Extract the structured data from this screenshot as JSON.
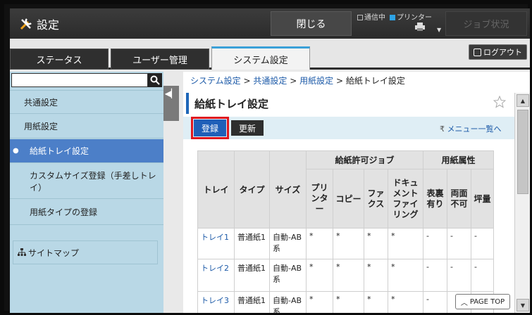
{
  "topbar": {
    "title": "設定",
    "close_label": "閉じる",
    "status_comm": "通信中",
    "status_printer": "プリンター",
    "job_status_label": "ジョブ状況"
  },
  "tabs": [
    {
      "label": "ステータス"
    },
    {
      "label": "ユーザー管理"
    },
    {
      "label": "システム設定"
    }
  ],
  "logout_label": "ログアウト",
  "search": {
    "placeholder": "",
    "value": ""
  },
  "sidebar": {
    "items": [
      {
        "label": "共通設定"
      },
      {
        "label": "用紙設定"
      },
      {
        "label": "給紙トレイ設定"
      },
      {
        "label": "カスタムサイズ登録（手差しトレイ）"
      },
      {
        "label": "用紙タイプの登録"
      }
    ],
    "sitemap_label": "サイトマップ"
  },
  "breadcrumb": {
    "items": [
      "システム設定",
      "共通設定",
      "用紙設定",
      "給紙トレイ設定"
    ],
    "sep": ">"
  },
  "page_title": "給紙トレイ設定",
  "toolbar": {
    "register_label": "登録",
    "update_label": "更新",
    "menu_link_label": "メニュー一覧へ"
  },
  "table": {
    "group_headers": [
      "給紙許可ジョブ",
      "用紙属性"
    ],
    "col_headers": [
      "トレイ",
      "タイプ",
      "サイズ",
      "プリンター",
      "コピー",
      "ファクス",
      "ドキュメントファイリング",
      "表裏有り",
      "両面不可",
      "坪量"
    ],
    "rows": [
      {
        "tray": "トレイ1",
        "type": "普通紙1",
        "size": "自動-AB系",
        "printer": "*",
        "copy": "*",
        "fax": "*",
        "doc": "*",
        "hyouri": "-",
        "ryoumen": "-",
        "tsubo": "-"
      },
      {
        "tray": "トレイ2",
        "type": "普通紙1",
        "size": "自動-AB系",
        "printer": "*",
        "copy": "*",
        "fax": "*",
        "doc": "*",
        "hyouri": "-",
        "ryoumen": "-",
        "tsubo": "-"
      },
      {
        "tray": "トレイ3",
        "type": "普通紙1",
        "size": "自動-AB系",
        "printer": "*",
        "copy": "*",
        "fax": "*",
        "doc": "*",
        "hyouri": "-",
        "ryoumen": "",
        "tsubo": ""
      }
    ]
  },
  "pagetop_label": "PAGE TOP"
}
